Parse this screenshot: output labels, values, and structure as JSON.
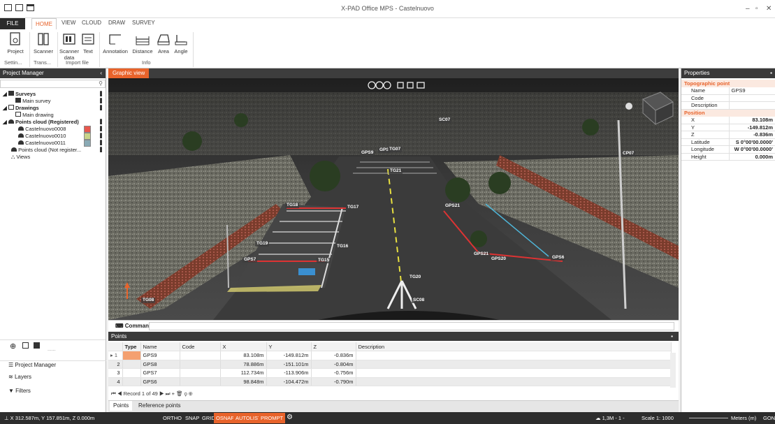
{
  "window": {
    "title": "X-PAD Office MPS - Castelnuovo"
  },
  "ribbon": {
    "tabs": [
      "FILE",
      "HOME",
      "VIEW",
      "CLOUD",
      "DRAW",
      "SURVEY"
    ],
    "active_tab": "HOME",
    "buttons": {
      "project": "Project",
      "scanner": "Scanner",
      "scanner_data": "Scanner data",
      "text": "Text",
      "annotation": "Annotation",
      "distance": "Distance",
      "area": "Area",
      "angle": "Angle"
    },
    "groups": {
      "settings": "Settin...",
      "trans": "Trans...",
      "import_file": "Import file",
      "info": "Info"
    }
  },
  "project_manager": {
    "title": "Project Manager",
    "tree": {
      "surveys": "Surveys",
      "main_survey": "Main survey",
      "drawings": "Drawings",
      "main_drawing": "Main drawing",
      "points_cloud_registered": "Points cloud (Registered)",
      "clouds": [
        {
          "name": "Castelnuovo0008",
          "color": "#e8584e"
        },
        {
          "name": "Castelnuovo0010",
          "color": "#c9d48a"
        },
        {
          "name": "Castelnuovo0011",
          "color": "#8aaab5"
        }
      ],
      "points_cloud_not_registered": "Points cloud (Not register...",
      "views": "Views"
    },
    "bottom": {
      "project_manager": "Project Manager",
      "layers": "Layers",
      "filters": "Filters"
    }
  },
  "graphic_view": {
    "tab": "Graphic view",
    "labels": [
      "SC07",
      "GPS9",
      "GPS",
      "TG07",
      "TG21",
      "CP07",
      "TG18",
      "TG17",
      "GPS21",
      "TG19",
      "TG16",
      "GPS21",
      "GPS20",
      "GPS6",
      "GPS7",
      "TG15",
      "TG20",
      "TG08",
      "SC08"
    ]
  },
  "command": {
    "label": "Command"
  },
  "points": {
    "title": "Points",
    "columns": [
      "Type",
      "Name",
      "Code",
      "X",
      "Y",
      "Z",
      "Description"
    ],
    "rows": [
      {
        "idx": "1",
        "name": "GPS9",
        "code": "",
        "x": "83.108m",
        "y": "-149.812m",
        "z": "-0.836m",
        "desc": ""
      },
      {
        "idx": "2",
        "name": "GPS8",
        "code": "",
        "x": "78.886m",
        "y": "-151.101m",
        "z": "-0.804m",
        "desc": ""
      },
      {
        "idx": "3",
        "name": "GPS7",
        "code": "",
        "x": "112.734m",
        "y": "-113.906m",
        "z": "-0.756m",
        "desc": ""
      },
      {
        "idx": "4",
        "name": "GPS6",
        "code": "",
        "x": "98.848m",
        "y": "-104.472m",
        "z": "-0.790m",
        "desc": ""
      }
    ],
    "record_nav": "Record 1 of 49",
    "tabs": [
      "Points",
      "Reference points"
    ]
  },
  "properties": {
    "title": "Properties",
    "section1": "Topographic point",
    "section2": "Position",
    "fields": {
      "name_label": "Name",
      "name_value": "GPS9",
      "code_label": "Code",
      "code_value": "",
      "desc_label": "Description",
      "desc_value": "",
      "x_label": "X",
      "x_value": "83.108m",
      "y_label": "Y",
      "y_value": "-149.812m",
      "z_label": "Z",
      "z_value": "-0.836m",
      "lat_label": "Latitude",
      "lat_value": "S 0°00'00.0000'",
      "lon_label": "Longitude",
      "lon_value": "W 0°00'00.0000'",
      "h_label": "Height",
      "h_value": "0.000m"
    }
  },
  "status_bar": {
    "coords": "X 312.587m, Y 157.851m, Z 0.000m",
    "ortho": "ORTHO",
    "snap": "SNAP",
    "grid": "GRID",
    "osnap": "OSNAP",
    "autolist": "AUTOLIST",
    "prompt": "PROMPT",
    "cloud_info": "1,3M - 1 -",
    "scale": "Scale 1: 1000",
    "units": "Meters (m)",
    "angle": "GON"
  },
  "colors": {
    "accent": "#e8632b",
    "dark": "#2d2d2d"
  }
}
